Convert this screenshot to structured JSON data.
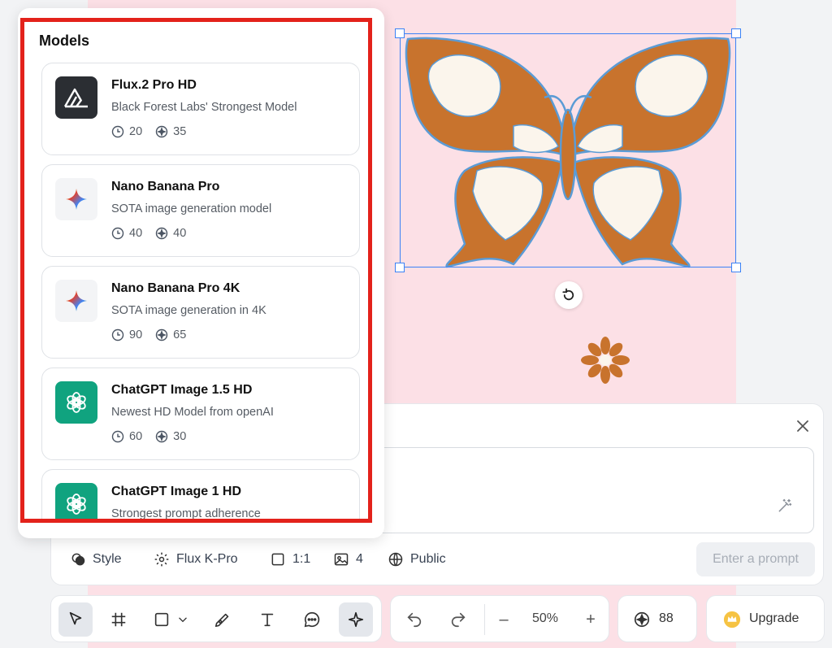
{
  "models_panel": {
    "title": "Models",
    "cards": [
      {
        "name": "Flux.2 Pro HD",
        "description": "Black Forest Labs' Strongest Model",
        "time": "20",
        "credits": "35",
        "logo": "flux-logo"
      },
      {
        "name": "Nano Banana Pro",
        "description": "SOTA image generation model",
        "time": "40",
        "credits": "40",
        "logo": "gemini-sparkle-logo"
      },
      {
        "name": "Nano Banana Pro 4K",
        "description": "SOTA image generation in 4K",
        "time": "90",
        "credits": "65",
        "logo": "gemini-sparkle-logo"
      },
      {
        "name": "ChatGPT Image 1.5 HD",
        "description": "Newest HD Model from openAI",
        "time": "60",
        "credits": "30",
        "logo": "openai-logo"
      },
      {
        "name": "ChatGPT Image 1 HD",
        "description": "Strongest prompt adherence",
        "time": "",
        "credits": "",
        "logo": "openai-logo"
      }
    ]
  },
  "prompt_bar": {
    "style_label": "Style",
    "model_label": "Flux K-Pro",
    "ratio_label": "1:1",
    "count_label": "4",
    "visibility_label": "Public",
    "submit_label": "Enter a prompt"
  },
  "bottom_toolbar": {
    "zoom_label": "50%",
    "zoom_out_label": "–",
    "zoom_in_label": "+",
    "credits_label": "88",
    "upgrade_label": "Upgrade"
  },
  "colors": {
    "accent_red": "#e3221b",
    "selection_blue": "#3b82f6",
    "canvas_pink": "#fce0e6",
    "flux_logo_bg": "#2b2e33",
    "openai_green": "#10a37f",
    "butterfly_orange": "#c8732d"
  }
}
